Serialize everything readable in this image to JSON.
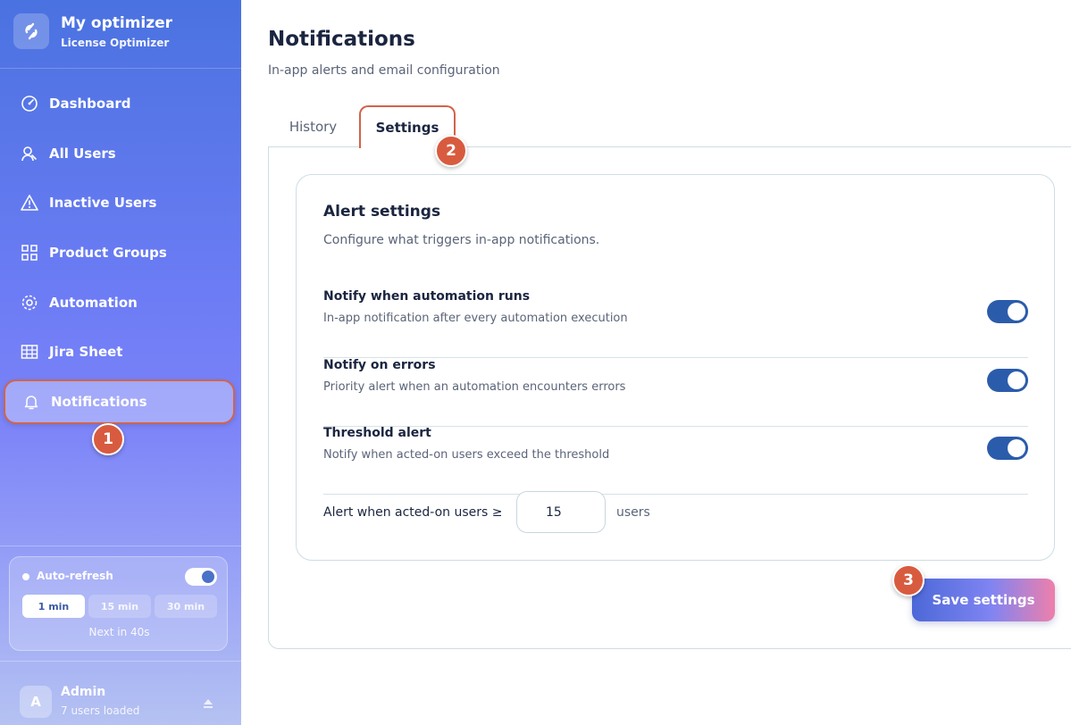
{
  "brand": {
    "title": "My optimizer",
    "subtitle": "License Optimizer"
  },
  "nav": {
    "items": [
      {
        "label": "Dashboard",
        "icon": "gauge-icon"
      },
      {
        "label": "All Users",
        "icon": "users-icon"
      },
      {
        "label": "Inactive Users",
        "icon": "warning-icon"
      },
      {
        "label": "Product Groups",
        "icon": "grid-icon"
      },
      {
        "label": "Automation",
        "icon": "gear-icon"
      },
      {
        "label": "Jira Sheet",
        "icon": "table-icon"
      },
      {
        "label": "Notifications",
        "icon": "bell-icon",
        "active": true
      }
    ]
  },
  "refresh": {
    "label": "Auto-refresh",
    "enabled": true,
    "intervals": [
      "1 min",
      "15 min",
      "30 min"
    ],
    "selected": "1 min",
    "next": "Next in 40s"
  },
  "user": {
    "initial": "A",
    "name": "Admin",
    "sub": "7 users loaded"
  },
  "page": {
    "title": "Notifications",
    "subtitle": "In-app alerts and email configuration"
  },
  "tabs": [
    {
      "label": "History"
    },
    {
      "label": "Settings",
      "active": true
    }
  ],
  "alert": {
    "title": "Alert settings",
    "subtitle": "Configure what triggers in-app notifications.",
    "settings": [
      {
        "title": "Notify when automation runs",
        "desc": "In-app notification after every automation execution",
        "enabled": true
      },
      {
        "title": "Notify on errors",
        "desc": "Priority alert when an automation encounters errors",
        "enabled": true
      },
      {
        "title": "Threshold alert",
        "desc": "Notify when acted-on users exceed the threshold",
        "enabled": true
      }
    ],
    "threshold": {
      "label": "Alert when acted-on users ≥",
      "value": "15",
      "unit": "users"
    }
  },
  "save_label": "Save settings",
  "steps": [
    "1",
    "2",
    "3"
  ],
  "colors": {
    "accent": "#2b5cab",
    "badge": "#d85b3f",
    "highlight": "#d0644c"
  }
}
